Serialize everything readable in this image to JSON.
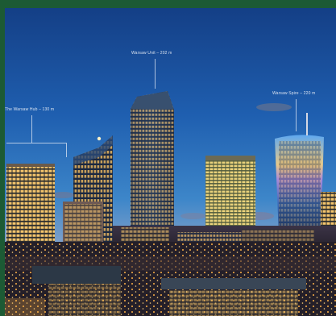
{
  "callouts": {
    "warsaw_unit": "Warsaw Unit – 202 m",
    "the_warsaw_hub": "The Warsaw Hub – 130 m",
    "warsaw_spire": "Warsaw Spire – 220 m"
  },
  "colors": {
    "frame_green": "#1c5a34",
    "sky_top": "#174f9c",
    "sky_mid": "#2f7cc7",
    "horizon": "#a894b8",
    "window_light": "#f4c36a",
    "city_lights": "#ffb347"
  }
}
